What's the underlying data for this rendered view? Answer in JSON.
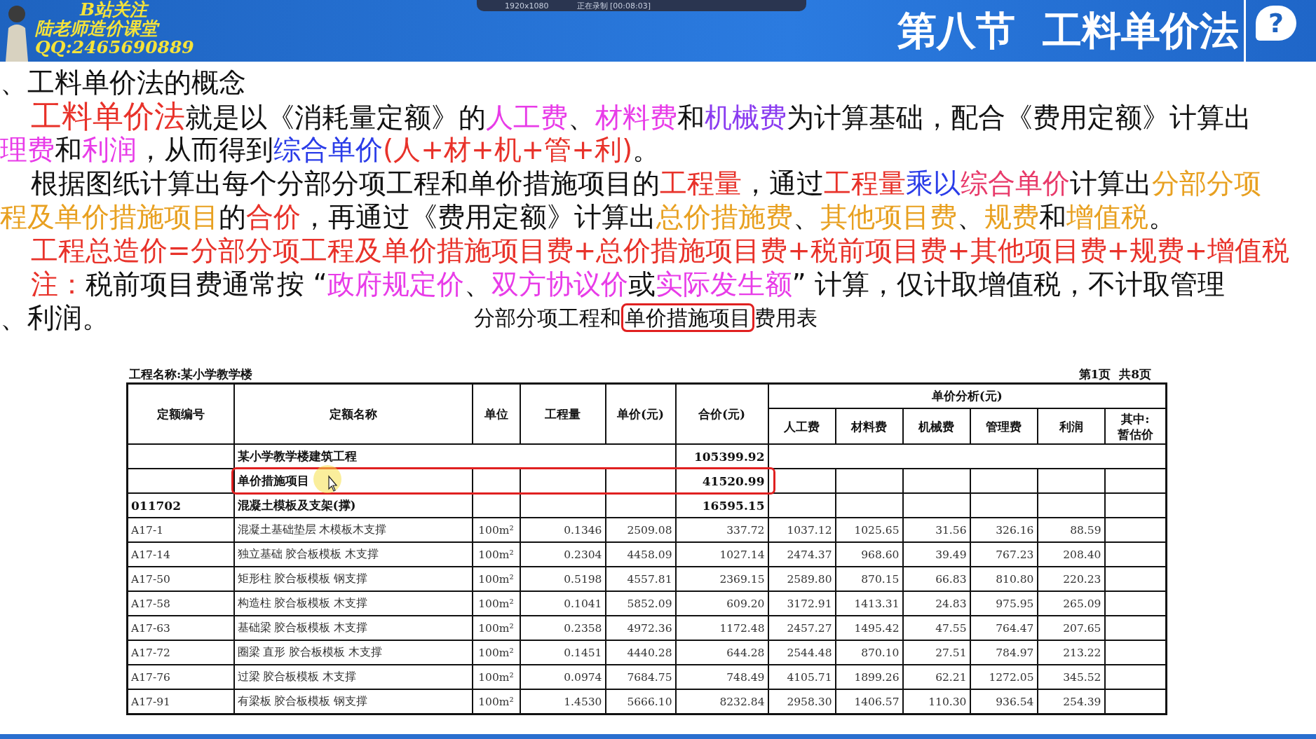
{
  "header": {
    "logo_lines": [
      "B站关注",
      "陆老师造价课堂",
      "QQ:2465690889"
    ],
    "recorder": {
      "size": "1920x1080",
      "status": "正在录制 [00:08:03]"
    },
    "title": "第八节  工料单价法",
    "help_glyph": "?"
  },
  "body": {
    "lines": [
      {
        "indent": false,
        "segments": [
          {
            "text": "、工料单价法的概念",
            "color": "#111111"
          }
        ]
      },
      {
        "indent": true,
        "segments": [
          {
            "text": "工料单价法",
            "color": "#e8322a",
            "large": true
          },
          {
            "text": "就是以《消耗量定额》的",
            "color": "#111111"
          },
          {
            "text": "人工费",
            "color": "#e83ce8"
          },
          {
            "text": "、",
            "color": "#111111"
          },
          {
            "text": "材料费",
            "color": "#e83ce8"
          },
          {
            "text": "和",
            "color": "#111111"
          },
          {
            "text": "机械费",
            "color": "#8a3cf0"
          },
          {
            "text": "为计算基础，配合《费用定额》计算出",
            "color": "#111111"
          }
        ]
      },
      {
        "indent": false,
        "segments": [
          {
            "text": "理费",
            "color": "#e83ce8"
          },
          {
            "text": "和",
            "color": "#111111"
          },
          {
            "text": "利润",
            "color": "#e83ce8"
          },
          {
            "text": "，从而得到",
            "color": "#111111"
          },
          {
            "text": "综合单价",
            "color": "#2a3ce8"
          },
          {
            "text": "(人+材+机+管+利)",
            "color": "#e8322a"
          },
          {
            "text": "。",
            "color": "#111111"
          }
        ]
      },
      {
        "indent": true,
        "segments": [
          {
            "text": "根据图纸计算出每个分部分项工程和单价措施项目的",
            "color": "#111111"
          },
          {
            "text": "工程量",
            "color": "#e8322a"
          },
          {
            "text": "，通过",
            "color": "#111111"
          },
          {
            "text": "工程量",
            "color": "#e8322a"
          },
          {
            "text": "乘以",
            "color": "#2a3ce8"
          },
          {
            "text": "综合单价",
            "color": "#e83a6a"
          },
          {
            "text": "计算出",
            "color": "#111111"
          },
          {
            "text": "分部分项",
            "color": "#e8a020"
          }
        ]
      },
      {
        "indent": false,
        "segments": [
          {
            "text": "程及单价措施项目",
            "color": "#e8a020"
          },
          {
            "text": "的",
            "color": "#111111"
          },
          {
            "text": "合价",
            "color": "#e8322a"
          },
          {
            "text": "，再通过《费用定额》计算出",
            "color": "#111111"
          },
          {
            "text": "总价措施费",
            "color": "#e8a020"
          },
          {
            "text": "、",
            "color": "#111111"
          },
          {
            "text": "其他项目费",
            "color": "#e8a020"
          },
          {
            "text": "、",
            "color": "#111111"
          },
          {
            "text": "规费",
            "color": "#e8a020"
          },
          {
            "text": "和",
            "color": "#111111"
          },
          {
            "text": "增值税",
            "color": "#e8a020"
          },
          {
            "text": "。",
            "color": "#111111"
          }
        ]
      },
      {
        "indent": true,
        "segments": [
          {
            "text": "工程总造价=分部分项工程及单价措施项目费+总价措施项目费+税前项目费+其他项目费+规费+增值税",
            "color": "#e8322a"
          }
        ]
      },
      {
        "indent": true,
        "segments": [
          {
            "text": "注：",
            "color": "#e8322a"
          },
          {
            "text": "税前项目费通常按 “",
            "color": "#111111"
          },
          {
            "text": "政府规定价",
            "color": "#e83ce8"
          },
          {
            "text": "、",
            "color": "#111111"
          },
          {
            "text": "双方协议价",
            "color": "#e83ce8"
          },
          {
            "text": "或",
            "color": "#111111"
          },
          {
            "text": "实际发生额",
            "color": "#e83ce8"
          },
          {
            "text": "” 计算，仅计取增值税，不计取管理",
            "color": "#111111"
          }
        ]
      },
      {
        "indent": false,
        "segments": [
          {
            "text": "、利润。",
            "color": "#111111"
          }
        ]
      }
    ],
    "caption": {
      "segments": [
        {
          "text": "分部分项工程和",
          "boxed": false
        },
        {
          "text": "单价措施项目",
          "boxed": true
        },
        {
          "text": "费用表",
          "boxed": false
        }
      ]
    }
  },
  "table": {
    "project": "工程名称:某小学教学楼",
    "page": "第1页  共8页",
    "columns": [
      "定额编号",
      "定额名称",
      "单位",
      "工程量",
      "单价(元)",
      "合价(元)"
    ],
    "group_header": "单价分析(元)",
    "sub_columns": [
      [
        "人工费"
      ],
      [
        "材料费"
      ],
      [
        "机械费"
      ],
      [
        "管理费"
      ],
      [
        "利润"
      ],
      [
        "其中:",
        "暂估价"
      ]
    ],
    "rows": [
      {
        "kind": "project",
        "name": "某小学教学楼建筑工程",
        "total": "105399.92"
      },
      {
        "kind": "section",
        "name": "单价措施项目",
        "total": "41520.99",
        "highlighted": true
      },
      {
        "kind": "subsection",
        "code": "011702",
        "name": "混凝土模板及支架(撑)",
        "total": "16595.15"
      },
      {
        "kind": "item",
        "code": "A17-1",
        "name": "混凝土基础垫层 木模板木支撑",
        "unit": "100m²",
        "qty": "0.1346",
        "price": "2509.08",
        "total": "337.72",
        "analysis": [
          "1037.12",
          "1025.65",
          "31.56",
          "326.16",
          "88.59"
        ]
      },
      {
        "kind": "item",
        "code": "A17-14",
        "name": "独立基础 胶合板模板 木支撑",
        "unit": "100m²",
        "qty": "0.2304",
        "price": "4458.09",
        "total": "1027.14",
        "analysis": [
          "2474.37",
          "968.60",
          "39.49",
          "767.23",
          "208.40"
        ]
      },
      {
        "kind": "item",
        "code": "A17-50",
        "name": "矩形柱 胶合板模板 钢支撑",
        "unit": "100m²",
        "qty": "0.5198",
        "price": "4557.81",
        "total": "2369.15",
        "analysis": [
          "2589.80",
          "870.15",
          "66.83",
          "810.80",
          "220.23"
        ]
      },
      {
        "kind": "item",
        "code": "A17-58",
        "name": "构造柱 胶合板模板 木支撑",
        "unit": "100m²",
        "qty": "0.1041",
        "price": "5852.09",
        "total": "609.20",
        "analysis": [
          "3172.91",
          "1413.31",
          "24.83",
          "975.95",
          "265.09"
        ]
      },
      {
        "kind": "item",
        "code": "A17-63",
        "name": "基础梁 胶合板模板 木支撑",
        "unit": "100m²",
        "qty": "0.2358",
        "price": "4972.36",
        "total": "1172.48",
        "analysis": [
          "2457.27",
          "1495.42",
          "47.55",
          "764.47",
          "207.65"
        ]
      },
      {
        "kind": "item",
        "code": "A17-72",
        "name": "圈梁 直形 胶合板模板 木支撑",
        "unit": "100m²",
        "qty": "0.1451",
        "price": "4440.28",
        "total": "644.28",
        "analysis": [
          "2544.48",
          "870.10",
          "27.51",
          "784.97",
          "213.22"
        ]
      },
      {
        "kind": "item",
        "code": "A17-76",
        "name": "过梁 胶合板模板 木支撑",
        "unit": "100m²",
        "qty": "0.0974",
        "price": "7684.75",
        "total": "748.49",
        "analysis": [
          "4105.71",
          "1899.26",
          "62.21",
          "1272.05",
          "345.52"
        ]
      },
      {
        "kind": "item",
        "code": "A17-91",
        "name": "有梁板 胶合板模板 钢支撑",
        "unit": "100m²",
        "qty": "1.4530",
        "price": "5666.10",
        "total": "8232.84",
        "analysis": [
          "2958.30",
          "1406.57",
          "110.30",
          "936.54",
          "254.39"
        ]
      }
    ]
  }
}
